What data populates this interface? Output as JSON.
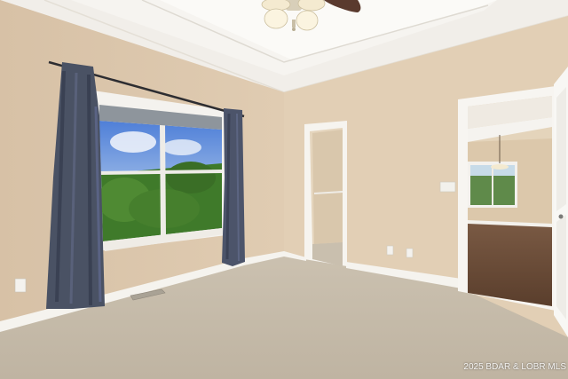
{
  "watermark": {
    "text": "2025 BDAR & LOBR MLS"
  },
  "colors": {
    "left_wall": "#dcc7ad",
    "back_wall": "#e3d0b6",
    "ceiling": "#f2efea",
    "carpet": "#c6bcac",
    "trim": "#f6f4ef",
    "curtain": "#4b5363",
    "hardwood": "#6b4c36",
    "fan": "#5a3a2e"
  },
  "icons": [
    "ceiling-fan-icon",
    "light-switch-icon",
    "outlet-icon",
    "floor-vent-icon"
  ]
}
